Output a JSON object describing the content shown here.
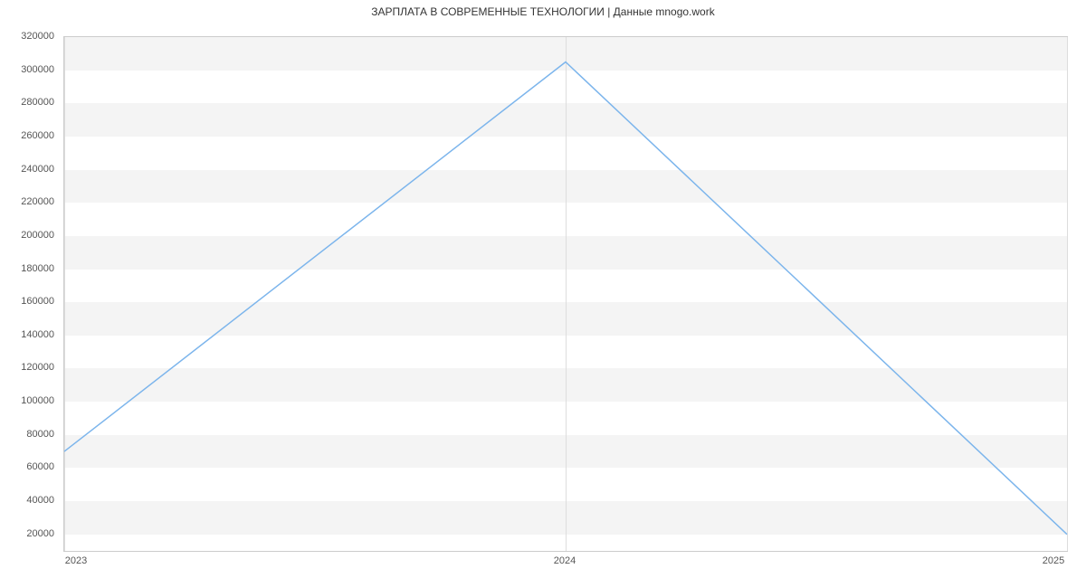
{
  "chart_data": {
    "type": "line",
    "title": "ЗАРПЛАТА В СОВРЕМЕННЫЕ ТЕХНОЛОГИИ | Данные mnogo.work",
    "x": [
      2023,
      2024,
      2025
    ],
    "values": [
      70000,
      305000,
      20000
    ],
    "xlabel": "",
    "ylabel": "",
    "ylim": [
      10000,
      320000
    ],
    "x_ticks": [
      2023,
      2024,
      2025
    ],
    "y_ticks": [
      20000,
      40000,
      60000,
      80000,
      100000,
      120000,
      140000,
      160000,
      180000,
      200000,
      220000,
      240000,
      260000,
      280000,
      300000,
      320000
    ],
    "line_color": "#7cb5ec",
    "grid": true
  }
}
